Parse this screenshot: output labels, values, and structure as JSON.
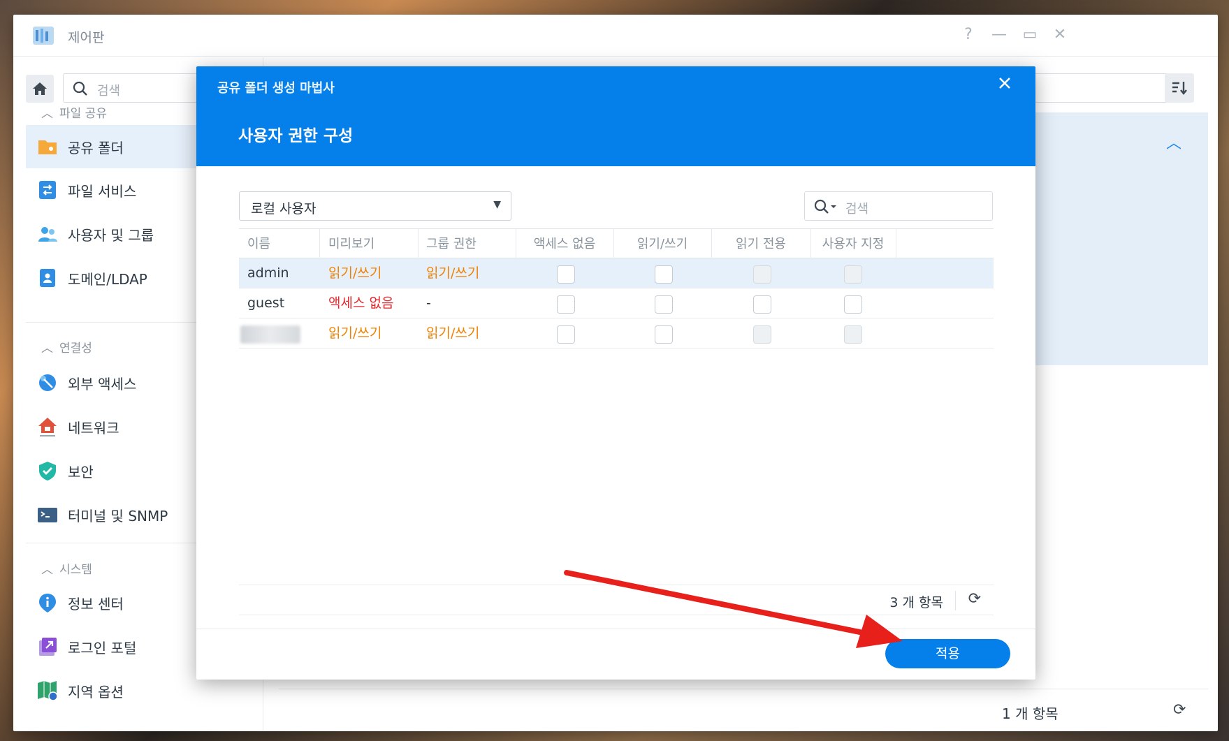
{
  "window": {
    "title": "제어판",
    "controls": {
      "help": "?",
      "minimize": "—",
      "maximize": "▭",
      "close": "✕"
    }
  },
  "sidebar": {
    "search_placeholder": "검색",
    "sections": [
      {
        "title": "파일 공유",
        "items": [
          {
            "label": "공유 폴더",
            "icon": "shared-folder-icon",
            "color": "#f4a93a",
            "active": true
          },
          {
            "label": "파일 서비스",
            "icon": "file-services-icon",
            "color": "#2f8de4"
          },
          {
            "label": "사용자 및 그룹",
            "icon": "users-groups-icon",
            "color": "#3ea3e8"
          },
          {
            "label": "도메인/LDAP",
            "icon": "domain-ldap-icon",
            "color": "#2f8de4"
          }
        ]
      },
      {
        "title": "연결성",
        "items": [
          {
            "label": "외부 액세스",
            "icon": "external-access-icon",
            "color": "#2f8de4"
          },
          {
            "label": "네트워크",
            "icon": "network-icon",
            "color": "#e0523a"
          },
          {
            "label": "보안",
            "icon": "security-shield-icon",
            "color": "#21b8a6"
          },
          {
            "label": "터미널 및 SNMP",
            "icon": "terminal-icon",
            "color": "#3c5f86"
          }
        ]
      },
      {
        "title": "시스템",
        "items": [
          {
            "label": "정보 센터",
            "icon": "info-center-icon",
            "color": "#2f8de4"
          },
          {
            "label": "로그인 포털",
            "icon": "login-portal-icon",
            "color": "#8a4fd6"
          },
          {
            "label": "지역 옵션",
            "icon": "regional-options-icon",
            "color": "#2fa36b"
          }
        ]
      }
    ]
  },
  "main": {
    "bottom_count": "1 개 항목"
  },
  "dialog": {
    "wizard_title": "공유 폴더 생성 마법사",
    "step_title": "사용자 권한 구성",
    "user_type": "로컬 사용자",
    "search_placeholder": "검색",
    "columns": [
      "이름",
      "미리보기",
      "그룹 권한",
      "액세스 없음",
      "읽기/쓰기",
      "읽기 전용",
      "사용자 지정"
    ],
    "rows": [
      {
        "name": "admin",
        "preview": "읽기/쓰기",
        "group": "읽기/쓰기",
        "preview_color": "orange",
        "group_color": "orange",
        "selected": true,
        "disabled_cols": [
          5,
          6
        ]
      },
      {
        "name": "guest",
        "preview": "액세스 없음",
        "group": "-",
        "preview_color": "red",
        "group_color": "plain",
        "selected": false,
        "disabled_cols": []
      },
      {
        "name": "",
        "preview": "읽기/쓰기",
        "group": "읽기/쓰기",
        "preview_color": "orange",
        "group_color": "orange",
        "selected": false,
        "disabled_cols": [
          5,
          6
        ],
        "name_redacted": true
      }
    ],
    "item_count": "3 개 항목",
    "apply_label": "적용"
  },
  "colors": {
    "accent": "#057fea",
    "orange": "#f08200",
    "red": "#e6262a",
    "arrow": "#e8201c"
  }
}
